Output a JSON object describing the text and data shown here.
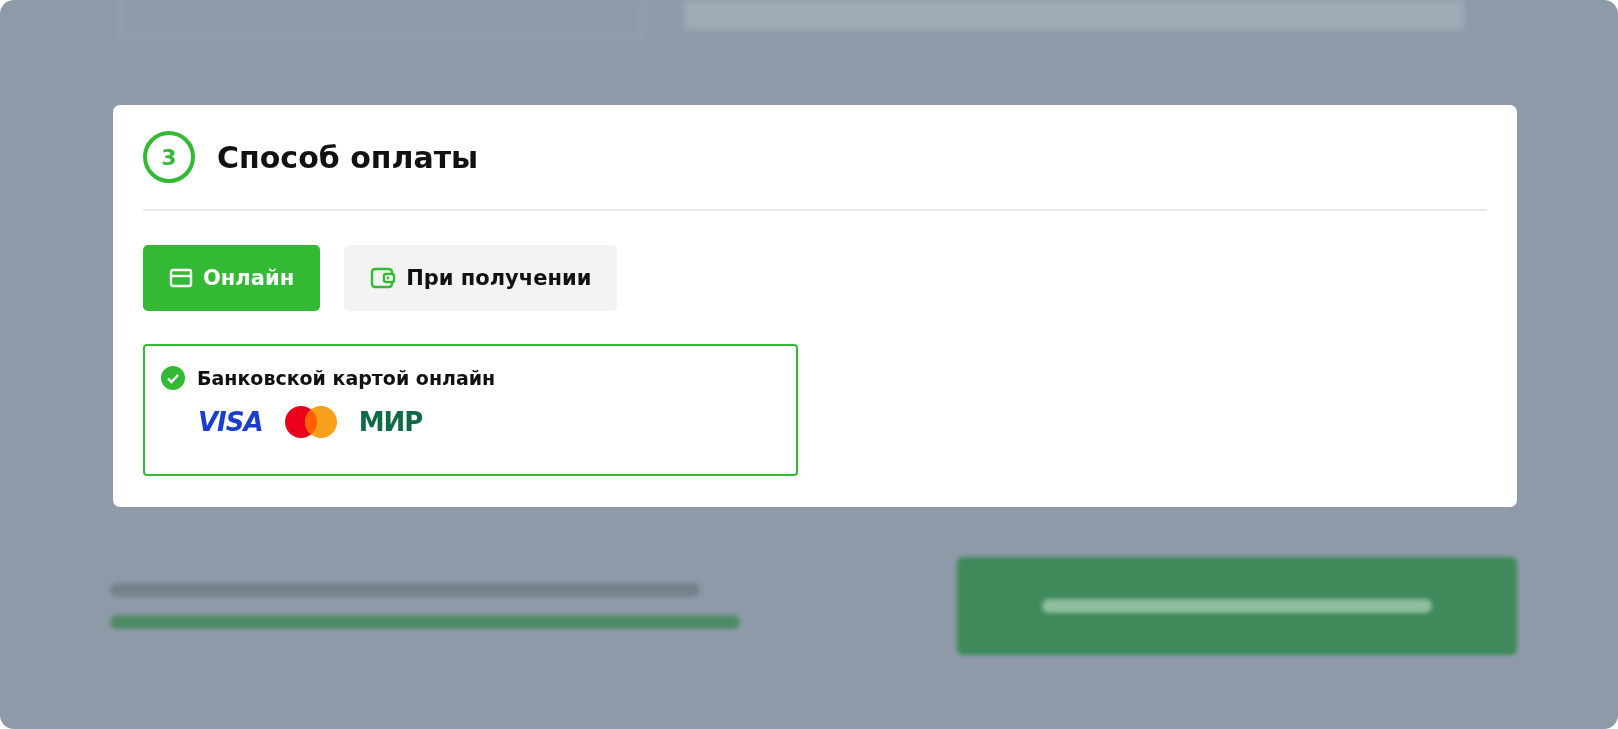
{
  "section": {
    "step": "3",
    "title": "Способ оплаты"
  },
  "tabs": [
    {
      "label": "Онлайн",
      "kind": "card",
      "selected": true
    },
    {
      "label": "При получении",
      "kind": "wallet",
      "selected": false
    }
  ],
  "options": [
    {
      "label": "Банковской картой онлайн",
      "selected": true,
      "logos": [
        {
          "kind": "visa",
          "text": "VISA"
        },
        {
          "kind": "mastercard"
        },
        {
          "kind": "mir",
          "text": "МИР"
        }
      ]
    }
  ]
}
